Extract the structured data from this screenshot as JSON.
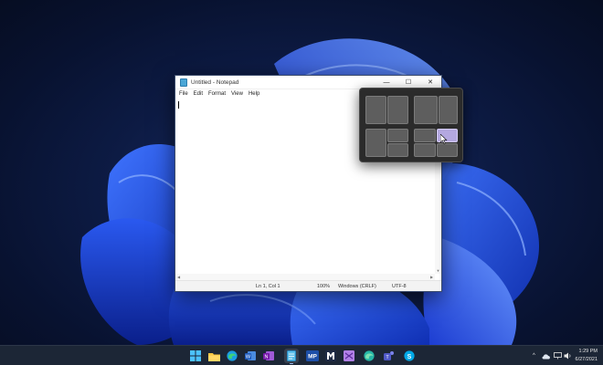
{
  "window": {
    "title": "Untitled - Notepad",
    "minimize_glyph": "—",
    "maximize_glyph": "☐",
    "close_glyph": "✕",
    "menu": [
      "File",
      "Edit",
      "Format",
      "View",
      "Help"
    ]
  },
  "statusbar": {
    "position": "Ln 1, Col 1",
    "zoom": "100%",
    "line_endings": "Windows (CRLF)",
    "encoding": "UTF-8"
  },
  "snap_layouts": {
    "hovered_zone": "four-grid-top-right",
    "highlight_color": "#b4a8e0"
  },
  "taskbar": {
    "icons": [
      {
        "name": "start-icon",
        "active": false
      },
      {
        "name": "file-explorer-icon",
        "active": false
      },
      {
        "name": "edge-icon",
        "active": false
      },
      {
        "name": "word-icon",
        "active": false
      },
      {
        "name": "onenote-icon",
        "active": false
      },
      {
        "name": "notepad-icon",
        "active": true
      },
      {
        "name": "mp-app-icon",
        "active": false
      },
      {
        "name": "teams-icon",
        "active": false
      },
      {
        "name": "visual-studio-icon",
        "active": false
      },
      {
        "name": "edge-dev-icon",
        "active": false
      },
      {
        "name": "teams-chat-icon",
        "active": false
      },
      {
        "name": "skype-icon",
        "active": false
      }
    ],
    "mp_label": "MP"
  },
  "tray": {
    "chevron": "^",
    "time": "1:29 PM",
    "date": "6/27/2021"
  },
  "colors": {
    "taskbar": "#1c2636",
    "accent": "#4aa6d6"
  }
}
